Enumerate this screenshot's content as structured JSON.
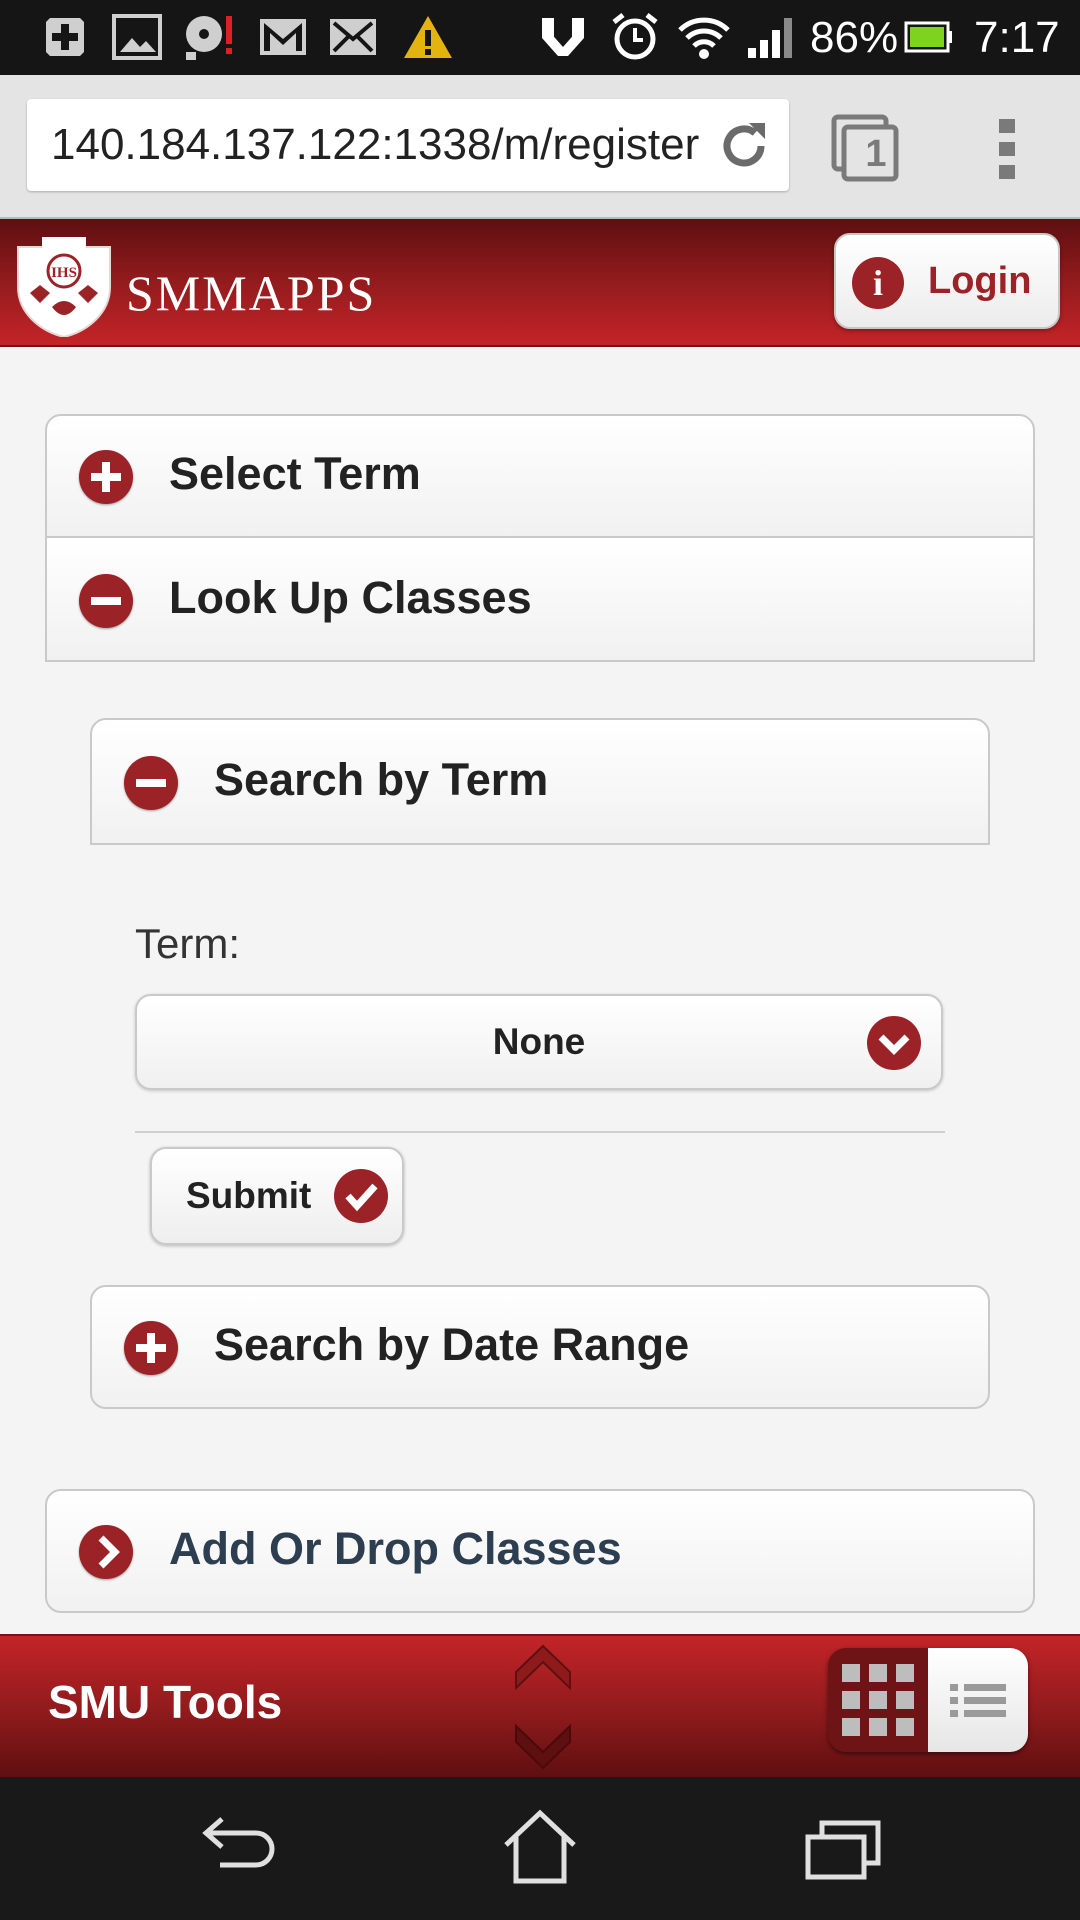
{
  "status_bar": {
    "battery_percent": "86%",
    "time": "7:17",
    "icons": [
      "add-notification-icon",
      "image-icon",
      "media-icon",
      "gmail-icon",
      "mail-icon",
      "warning-icon",
      "nfc-icon",
      "alarm-icon",
      "wifi-icon",
      "signal-icon",
      "battery-icon"
    ]
  },
  "browser": {
    "url": "140.184.137.122:1338/m/register",
    "tab_count": "1"
  },
  "header": {
    "brand": "SMMAPPS",
    "crest_text": "IHS",
    "login_label": "Login",
    "login_icon_glyph": "i"
  },
  "sections": {
    "select_term": {
      "label": "Select Term",
      "state": "collapsed"
    },
    "look_up_classes": {
      "label": "Look Up Classes",
      "state": "expanded"
    },
    "search_by_term": {
      "label": "Search by Term",
      "state": "expanded"
    },
    "search_by_date_range": {
      "label": "Search by Date Range",
      "state": "collapsed"
    },
    "add_drop_classes": {
      "label": "Add Or Drop Classes"
    }
  },
  "form": {
    "term_label": "Term:",
    "term_value": "None",
    "submit_label": "Submit"
  },
  "toolbar": {
    "title": "SMU Tools",
    "active_view": "list"
  },
  "colors": {
    "accent": "#9b2226",
    "header_dark": "#5e0f10",
    "header_light": "#c42428"
  }
}
